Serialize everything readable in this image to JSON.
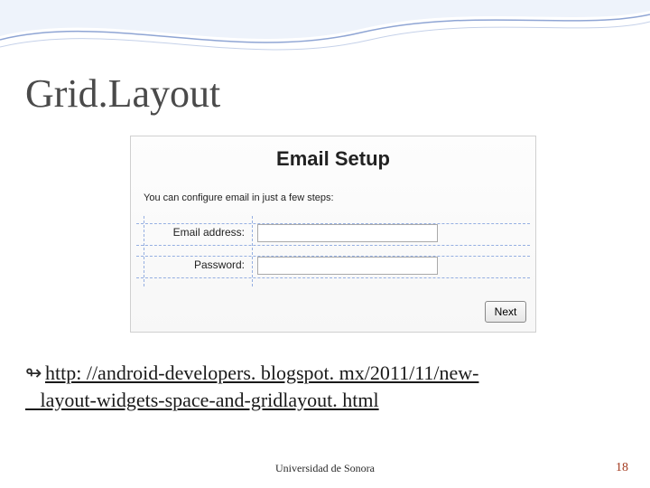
{
  "slide": {
    "title": "Grid.Layout",
    "footer": "Universidad de Sonora",
    "page_num": "18"
  },
  "figure": {
    "title": "Email Setup",
    "subtitle": "You can configure email in just a few steps:",
    "email_label": "Email address:",
    "password_label": "Password:",
    "email_value": "",
    "password_value": "",
    "next_label": "Next"
  },
  "link": {
    "line1": "http: //android-developers. blogspot. mx/2011/11/new-",
    "line2": "layout-widgets-space-and-gridlayout. html"
  }
}
